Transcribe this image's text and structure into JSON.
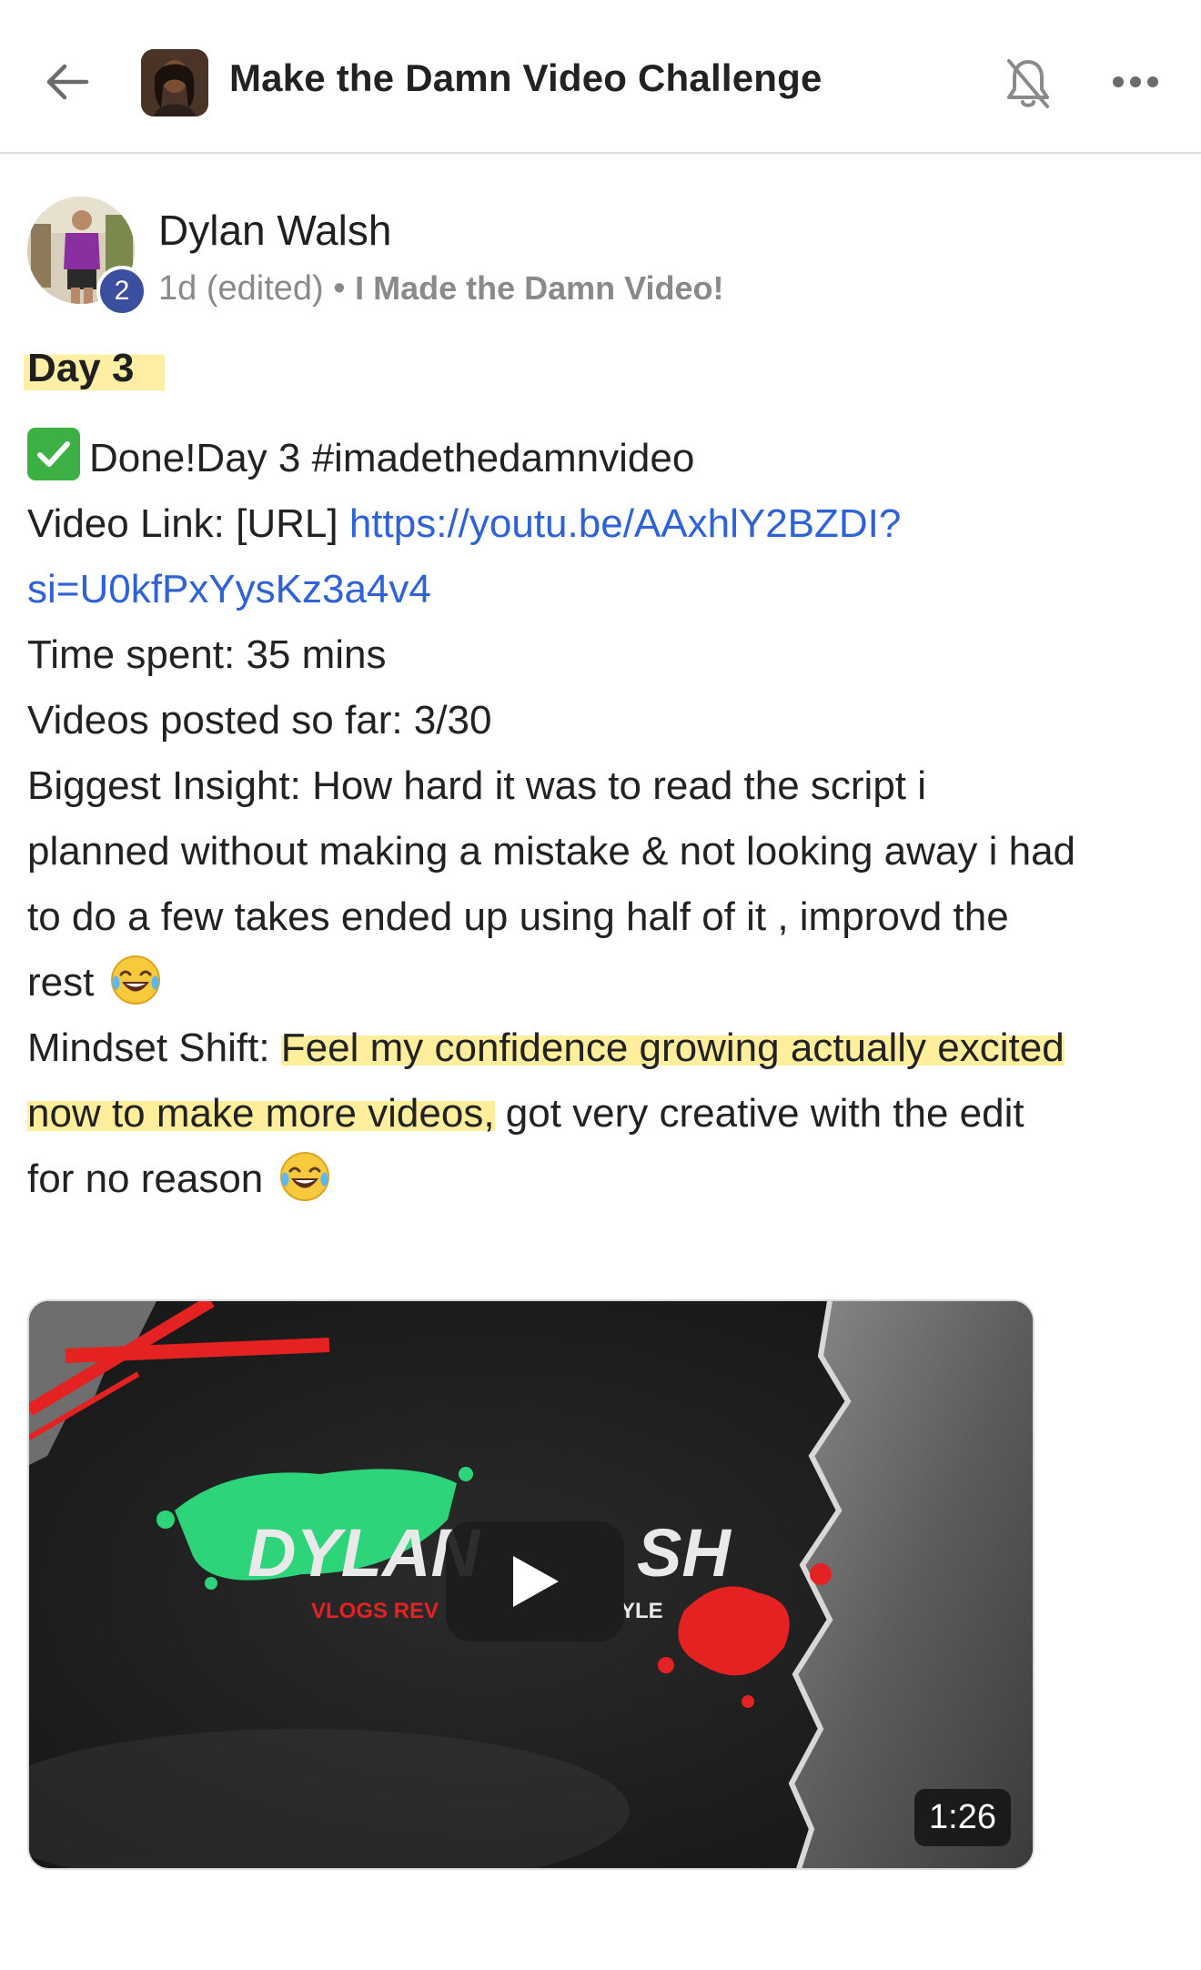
{
  "header": {
    "back_icon": "arrow-left-icon",
    "group_title": "Make the Damn Video Challenge",
    "bell_icon": "bell-off-icon",
    "more_icon": "more-horizontal-icon"
  },
  "post": {
    "author": {
      "name": "Dylan Walsh",
      "level": "2"
    },
    "meta": {
      "time": "1d (edited)",
      "separator": "•",
      "category": "I Made the Damn Video!"
    },
    "title": "Day 3",
    "body": {
      "line1_text": "Done!Day 3 #imadethedamnvideo",
      "line2_prefix": "Video Link: [URL] ",
      "line2_link": "https://youtu.be/AAxhlY2BZDI?",
      "line3_link": "si=U0kfPxYysKz3a4v4",
      "line4": "Time spent: 35 mins",
      "line5": "Videos posted so far: 3/30",
      "line6": "Biggest Insight: How hard it was to read the script i",
      "line7": "planned without making a mistake & not looking away i had",
      "line8": "to do a few takes ended up using half of it , improvd the",
      "line9": "rest",
      "line10_prefix": "Mindset Shift: ",
      "line10_highlight": "Feel my confidence growing actually excited",
      "line11_highlight": "now to make more videos,",
      "line11_rest": " got very creative with the edit",
      "line12": "for no reason"
    },
    "video": {
      "thumb_title_left": "DYLAN",
      "thumb_title_right": "SH",
      "thumb_subtitle_left": "VLOGS REV",
      "thumb_subtitle_right": "YLE",
      "duration": "1:26"
    }
  },
  "colors": {
    "link": "#2f62d6",
    "highlight": "#ffe25a",
    "badge": "#3a4fa0",
    "check": "#3cb043"
  }
}
